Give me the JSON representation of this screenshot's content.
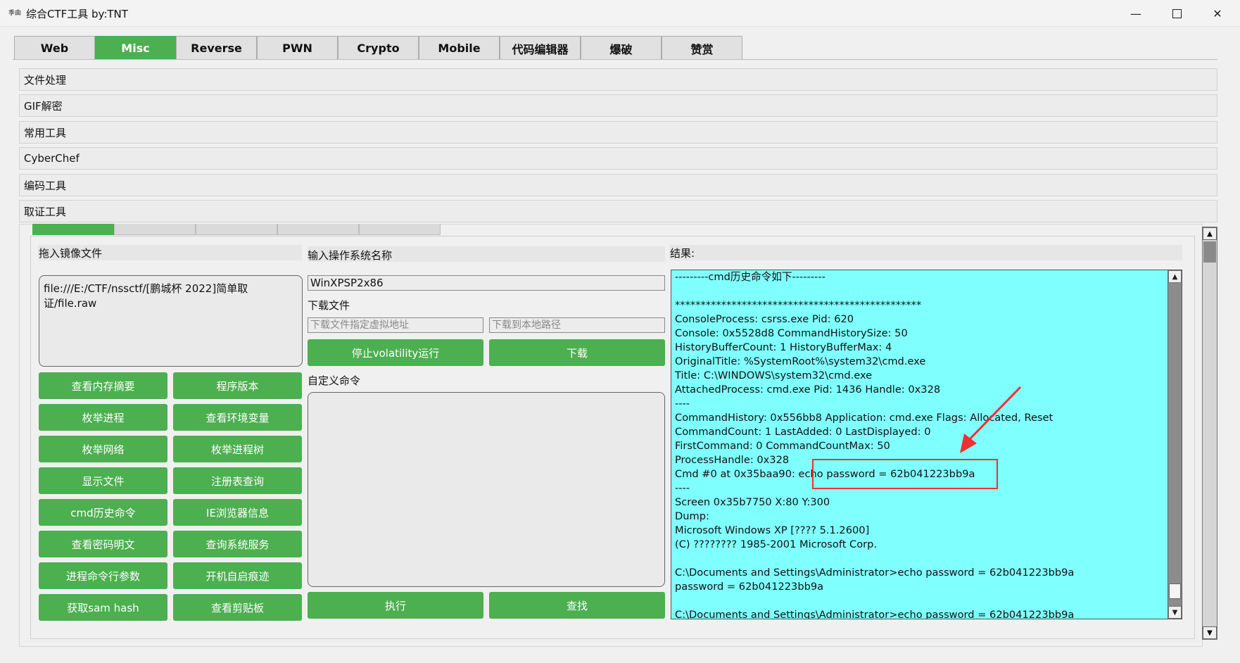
{
  "window": {
    "app_icon": "季曲",
    "title": "综合CTF工具   by:TNT",
    "min_glyph": "—",
    "close_glyph": "✕"
  },
  "tabs": [
    {
      "label": "Web"
    },
    {
      "label": "Misc",
      "active": true
    },
    {
      "label": "Reverse"
    },
    {
      "label": "PWN"
    },
    {
      "label": "Crypto"
    },
    {
      "label": "Mobile"
    },
    {
      "label": "代码编辑器"
    },
    {
      "label": "爆破"
    },
    {
      "label": "赞赏"
    }
  ],
  "sections": [
    {
      "label": "文件处理"
    },
    {
      "label": "GIF解密"
    },
    {
      "label": "常用工具"
    },
    {
      "label": "CyberChef"
    },
    {
      "label": "编码工具"
    },
    {
      "label": "取证工具"
    }
  ],
  "forensics": {
    "image_label": "拖入镜像文件",
    "image_path": "file:///E:/CTF/nssctf/[鹏城杯 2022]简单取证/file.raw",
    "os_label": "输入操作系统名称",
    "os_value": "WinXPSP2x86",
    "download_label": "下载文件",
    "vaddr_placeholder": "下载文件指定虚拟地址",
    "local_placeholder": "下载到本地路径",
    "stop_button": "停止volatility运行",
    "download_button": "下载",
    "custom_cmd_label": "自定义命令",
    "execute_button": "执行",
    "search_button": "查找",
    "result_label": "结果:",
    "buttons_left": [
      "查看内存摘要",
      "枚举进程",
      "枚举网络",
      "显示文件",
      "cmd历史命令",
      "查看密码明文",
      "进程命令行参数",
      "获取sam hash"
    ],
    "buttons_right": [
      "程序版本",
      "查看环境变量",
      "枚举进程树",
      "注册表查询",
      "IE浏览器信息",
      "查询系统服务",
      "开机自启痕迹",
      "查看剪贴板"
    ]
  },
  "result_text": "---------cmd历史命令如下---------\n\n************************************************\nConsoleProcess: csrss.exe Pid: 620\nConsole: 0x5528d8 CommandHistorySize: 50\nHistoryBufferCount: 1 HistoryBufferMax: 4\nOriginalTitle: %SystemRoot%\\system32\\cmd.exe\nTitle: C:\\WINDOWS\\system32\\cmd.exe\nAttachedProcess: cmd.exe Pid: 1436 Handle: 0x328\n----\nCommandHistory: 0x556bb8 Application: cmd.exe Flags: Allocated, Reset\nCommandCount: 1 LastAdded: 0 LastDisplayed: 0\nFirstCommand: 0 CommandCountMax: 50\nProcessHandle: 0x328\nCmd #0 at 0x35baa90: echo password = 62b041223bb9a\n----\nScreen 0x35b7750 X:80 Y:300\nDump:\nMicrosoft Windows XP [???? 5.1.2600]\n(C) ???????? 1985-2001 Microsoft Corp.\n\nC:\\Documents and Settings\\Administrator>echo password = 62b041223bb9a\npassword = 62b041223bb9a\n\nC:\\Documents and Settings\\Administrator>echo password = 62b041223bb9a"
}
